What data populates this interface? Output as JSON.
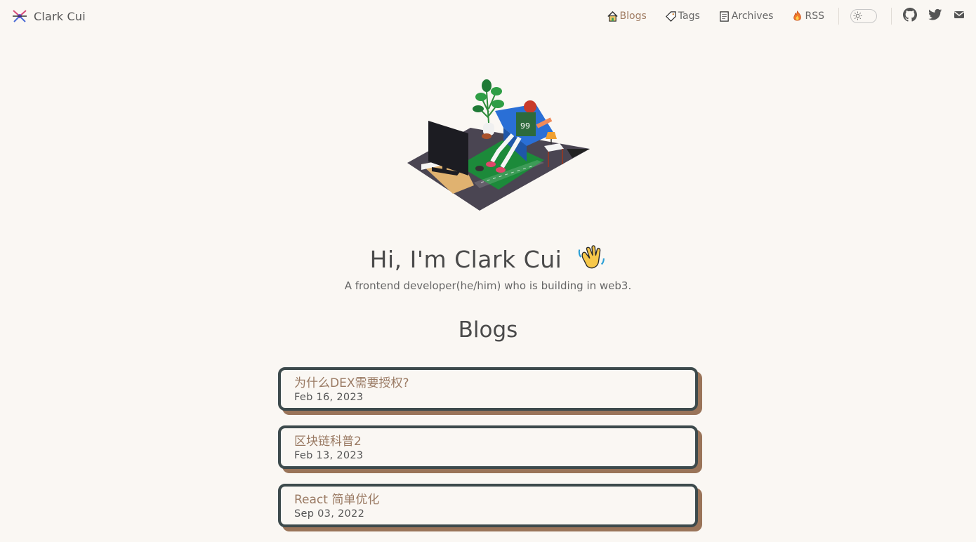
{
  "header": {
    "brand": "Clark Cui",
    "nav": [
      {
        "label": "Blogs",
        "icon": "house-icon",
        "active": true
      },
      {
        "label": "Tags",
        "icon": "tag-icon",
        "active": false
      },
      {
        "label": "Archives",
        "icon": "archive-icon",
        "active": false
      },
      {
        "label": "RSS",
        "icon": "fire-icon",
        "active": false
      }
    ],
    "theme_toggle_icon": "sun-icon",
    "social": [
      "github-icon",
      "twitter-icon",
      "mail-icon"
    ]
  },
  "hero": {
    "title": "Hi, I'm Clark Cui",
    "emoji_icon": "waving-hand-icon",
    "subtitle": "A frontend developer(he/him) who is building in web3."
  },
  "blogs": {
    "heading": "Blogs",
    "posts": [
      {
        "title": "为什么DEX需要授权?",
        "date": "Feb 16, 2023"
      },
      {
        "title": "区块链科普2",
        "date": "Feb 13, 2023"
      },
      {
        "title": "React 简单优化",
        "date": "Sep 03, 2022"
      }
    ]
  },
  "colors": {
    "background": "#faf7f3",
    "accent": "#a07c62",
    "card_border": "#3d4a4c",
    "card_shadow": "#9a7459"
  }
}
